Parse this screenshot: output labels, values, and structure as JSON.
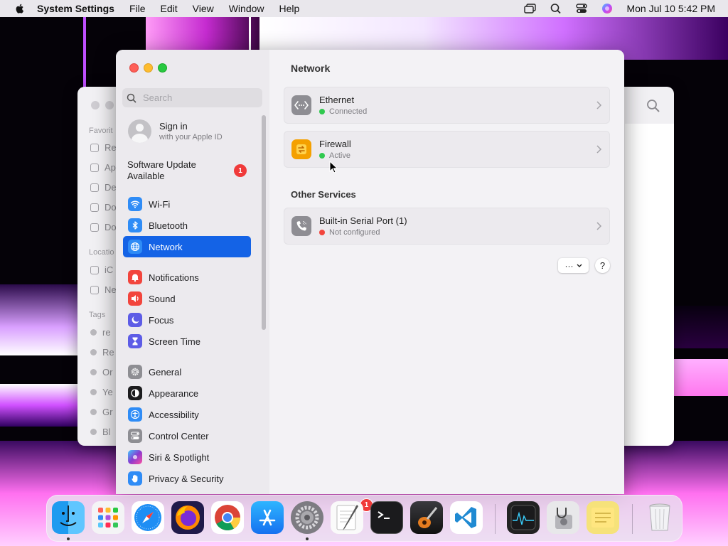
{
  "menubar": {
    "app_name": "System Settings",
    "items": [
      "File",
      "Edit",
      "View",
      "Window",
      "Help"
    ],
    "datetime": "Mon Jul 10  5:42 PM"
  },
  "finder": {
    "section_favorites": "Favorit",
    "section_locations": "Locatio",
    "section_tags": "Tags",
    "favorites": [
      "Re",
      "Ap",
      "De",
      "Do",
      "Do"
    ],
    "locations": [
      "iC",
      "Ne"
    ],
    "tags": [
      "re",
      "Re",
      "Or",
      "Ye",
      "Gr",
      "Bl"
    ]
  },
  "sidebar": {
    "search_placeholder": "Search",
    "signin_title": "Sign in",
    "signin_subtitle": "with your Apple ID",
    "update_label": "Software Update Available",
    "update_badge": "1",
    "items": [
      {
        "label": "Wi-Fi",
        "color": "#2f8cf6"
      },
      {
        "label": "Bluetooth",
        "color": "#2f8cf6"
      },
      {
        "label": "Network",
        "color": "#2f8cf6"
      },
      {
        "label": "Notifications",
        "color": "#f2453d"
      },
      {
        "label": "Sound",
        "color": "#f2453d"
      },
      {
        "label": "Focus",
        "color": "#5d5ce6"
      },
      {
        "label": "Screen Time",
        "color": "#5d5ce6"
      },
      {
        "label": "General",
        "color": "#8e8e93"
      },
      {
        "label": "Appearance",
        "color": "#1c1c1e"
      },
      {
        "label": "Accessibility",
        "color": "#2f8cf6"
      },
      {
        "label": "Control Center",
        "color": "#8e8e93"
      },
      {
        "label": "Siri & Spotlight",
        "color": "#8a3ad0"
      },
      {
        "label": "Privacy & Security",
        "color": "#2f8cf6"
      }
    ],
    "active_item": "Network"
  },
  "main": {
    "title": "Network",
    "services": [
      {
        "name": "Ethernet",
        "status": "Connected",
        "status_color": "#30c94f"
      },
      {
        "name": "Firewall",
        "status": "Active",
        "status_color": "#30c94f"
      }
    ],
    "other_services_heading": "Other Services",
    "other_services": [
      {
        "name": "Built-in Serial Port (1)",
        "status": "Not configured",
        "status_color": "#f2453d"
      }
    ],
    "more_label": "···",
    "help_label": "?"
  },
  "dock": {
    "apps": [
      "Finder",
      "Launchpad",
      "Safari",
      "Firefox",
      "Chrome",
      "App Store",
      "System Settings",
      "TextEdit",
      "Terminal",
      "GarageBand",
      "VS Code",
      "Activity Monitor",
      "Disk Utility",
      "Stickies",
      "Trash"
    ],
    "settings_badge": "1"
  }
}
